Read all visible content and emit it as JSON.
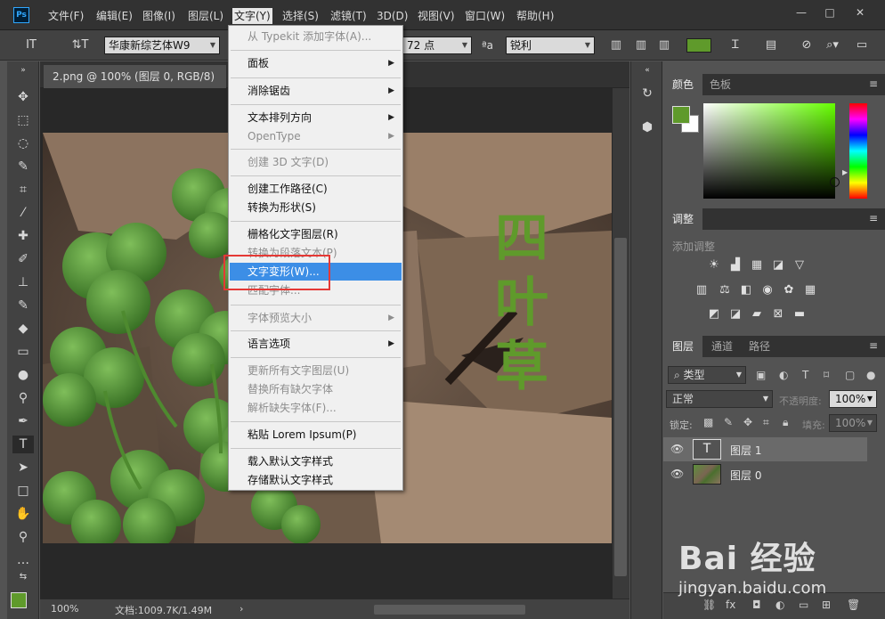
{
  "app": {
    "logo": "Ps"
  },
  "menubar": {
    "items": [
      "文件(F)",
      "编辑(E)",
      "图像(I)",
      "图层(L)",
      "文字(Y)",
      "选择(S)",
      "滤镜(T)",
      "3D(D)",
      "视图(V)",
      "窗口(W)",
      "帮助(H)"
    ],
    "active_index": 4
  },
  "window_controls": {
    "minimize": "—",
    "restore": "□",
    "close": "✕"
  },
  "options_bar": {
    "tool_glyph": "IT",
    "orient_glyph": "⇅T",
    "font_family": "华康新综艺体W9",
    "font_size": "72 点",
    "aa_glyph": "ªa",
    "antialias": "锐利",
    "swatch_color": "#5f9a2b"
  },
  "document": {
    "tab_title": "2.png @ 100% (图层 0, RGB/8)",
    "tab_close": "×",
    "zoom": "100%",
    "doc_info": "文档:1009.7K/1.49M",
    "status_arrow": "›"
  },
  "canvas_text": [
    "四",
    "叶",
    "草"
  ],
  "type_menu": {
    "items": [
      {
        "label": "从 Typekit 添加字体(A)...",
        "disabled": true,
        "submenu": false
      },
      {
        "label": "面板",
        "disabled": false,
        "submenu": true
      },
      {
        "label": "消除锯齿",
        "disabled": false,
        "submenu": true
      },
      {
        "label": "文本排列方向",
        "disabled": false,
        "submenu": true
      },
      {
        "label": "OpenType",
        "disabled": true,
        "submenu": true
      },
      {
        "label": "创建 3D 文字(D)",
        "disabled": true,
        "submenu": false
      },
      {
        "label": "创建工作路径(C)",
        "disabled": false,
        "submenu": false
      },
      {
        "label": "转换为形状(S)",
        "disabled": false,
        "submenu": false
      },
      {
        "label": "栅格化文字图层(R)",
        "disabled": false,
        "submenu": false
      },
      {
        "label": "转换为段落文本(P)",
        "disabled": true,
        "submenu": false
      },
      {
        "label": "文字变形(W)...",
        "disabled": false,
        "submenu": false,
        "highlighted": true
      },
      {
        "label": "匹配字体...",
        "disabled": true,
        "submenu": false
      },
      {
        "label": "字体预览大小",
        "disabled": true,
        "submenu": true
      },
      {
        "label": "语言选项",
        "disabled": false,
        "submenu": true
      },
      {
        "label": "更新所有文字图层(U)",
        "disabled": true,
        "submenu": false
      },
      {
        "label": "替换所有缺欠字体",
        "disabled": true,
        "submenu": false
      },
      {
        "label": "解析缺失字体(F)...",
        "disabled": true,
        "submenu": false
      },
      {
        "label": "粘贴 Lorem Ipsum(P)",
        "disabled": false,
        "submenu": false
      },
      {
        "label": "载入默认文字样式",
        "disabled": false,
        "submenu": false
      },
      {
        "label": "存储默认文字样式",
        "disabled": false,
        "submenu": false
      }
    ]
  },
  "color_panel": {
    "tabs": [
      "颜色",
      "色板"
    ],
    "active_tab": 0,
    "fg_color": "#5f9a2b",
    "bg_color": "#ffffff",
    "menu_glyph": "≡"
  },
  "adjust_panel": {
    "tab": "调整",
    "label": "添加调整"
  },
  "layers_panel": {
    "tabs": [
      "图层",
      "通道",
      "路径"
    ],
    "active_tab": 0,
    "filter": "类型",
    "blend_mode": "正常",
    "opacity_label": "不透明度:",
    "opacity_value": "100%",
    "lock_label": "锁定:",
    "fill_label": "填充:",
    "fill_value": "100%",
    "layers": [
      {
        "name": "图层 1",
        "type": "text",
        "thumb_glyph": "T",
        "selected": true
      },
      {
        "name": "图层 0",
        "type": "image",
        "selected": false
      }
    ]
  },
  "watermark": {
    "logo": "Bai 经验",
    "url": "jingyan.baidu.com"
  }
}
